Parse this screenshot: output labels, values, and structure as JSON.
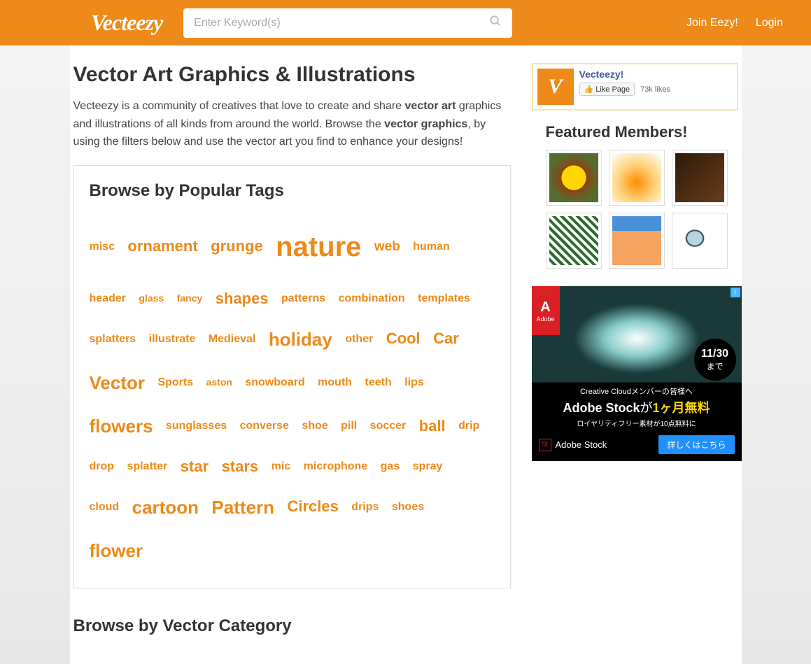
{
  "header": {
    "logo": "Vecteezy",
    "search_placeholder": "Enter Keyword(s)",
    "join_label": "Join Eezy!",
    "login_label": "Login"
  },
  "page": {
    "title": "Vector Art Graphics & Illustrations",
    "intro_1": "Vecteezy is a community of creatives that love to create and share ",
    "intro_bold_1": "vector art",
    "intro_2": " graphics and illustrations of all kinds from around the world. Browse the ",
    "intro_bold_2": "vector graphics",
    "intro_3": ", by using the filters below and use the vector art you find to enhance your designs!",
    "tags_title": "Browse by Popular Tags",
    "category_title": "Browse by Vector Category"
  },
  "tags": [
    {
      "label": "misc",
      "size": "s"
    },
    {
      "label": "ornament",
      "size": "l"
    },
    {
      "label": "grunge",
      "size": "l"
    },
    {
      "label": "nature",
      "size": "xxl"
    },
    {
      "label": "web",
      "size": "m"
    },
    {
      "label": "human",
      "size": "s"
    },
    {
      "label": "header",
      "size": "s"
    },
    {
      "label": "glass",
      "size": "xs"
    },
    {
      "label": "fancy",
      "size": "xs"
    },
    {
      "label": "shapes",
      "size": "l"
    },
    {
      "label": "patterns",
      "size": "s"
    },
    {
      "label": "combination",
      "size": "s"
    },
    {
      "label": "templates",
      "size": "s"
    },
    {
      "label": "splatters",
      "size": "s"
    },
    {
      "label": "illustrate",
      "size": "s"
    },
    {
      "label": "Medieval",
      "size": "s"
    },
    {
      "label": "holiday",
      "size": "xl"
    },
    {
      "label": "other",
      "size": "s"
    },
    {
      "label": "Cool",
      "size": "l"
    },
    {
      "label": "Car",
      "size": "l"
    },
    {
      "label": "Vector",
      "size": "xl"
    },
    {
      "label": "Sports",
      "size": "s"
    },
    {
      "label": "aston",
      "size": "xs"
    },
    {
      "label": "snowboard",
      "size": "s"
    },
    {
      "label": "mouth",
      "size": "s"
    },
    {
      "label": "teeth",
      "size": "s"
    },
    {
      "label": "lips",
      "size": "s"
    },
    {
      "label": "flowers",
      "size": "xl"
    },
    {
      "label": "sunglasses",
      "size": "s"
    },
    {
      "label": "converse",
      "size": "s"
    },
    {
      "label": "shoe",
      "size": "s"
    },
    {
      "label": "pill",
      "size": "s"
    },
    {
      "label": "soccer",
      "size": "s"
    },
    {
      "label": "ball",
      "size": "l"
    },
    {
      "label": "drip",
      "size": "s"
    },
    {
      "label": "drop",
      "size": "s"
    },
    {
      "label": "splatter",
      "size": "s"
    },
    {
      "label": "star",
      "size": "l"
    },
    {
      "label": "stars",
      "size": "l"
    },
    {
      "label": "mic",
      "size": "s"
    },
    {
      "label": "microphone",
      "size": "s"
    },
    {
      "label": "gas",
      "size": "s"
    },
    {
      "label": "spray",
      "size": "s"
    },
    {
      "label": "cloud",
      "size": "s"
    },
    {
      "label": "cartoon",
      "size": "xl"
    },
    {
      "label": "Pattern",
      "size": "xl"
    },
    {
      "label": "Circles",
      "size": "l"
    },
    {
      "label": "drips",
      "size": "s"
    },
    {
      "label": "shoes",
      "size": "s"
    },
    {
      "label": "flower",
      "size": "xl"
    }
  ],
  "facebook": {
    "name": "Vecteezy!",
    "like_label": "Like Page",
    "likes": "73k likes"
  },
  "featured": {
    "title": "Featured Members!"
  },
  "ad": {
    "adobe": "Adobe",
    "date": "11/30",
    "until": "まで",
    "line1": "Creative Cloudメンバーの皆様へ",
    "line2a": "Adobe Stock",
    "line2b": "が",
    "line2c": "1ヶ月無料",
    "line3": "ロイヤリティフリー素材が10点無料に",
    "stock_label": "Adobe Stock",
    "button": "詳しくはこちら"
  }
}
